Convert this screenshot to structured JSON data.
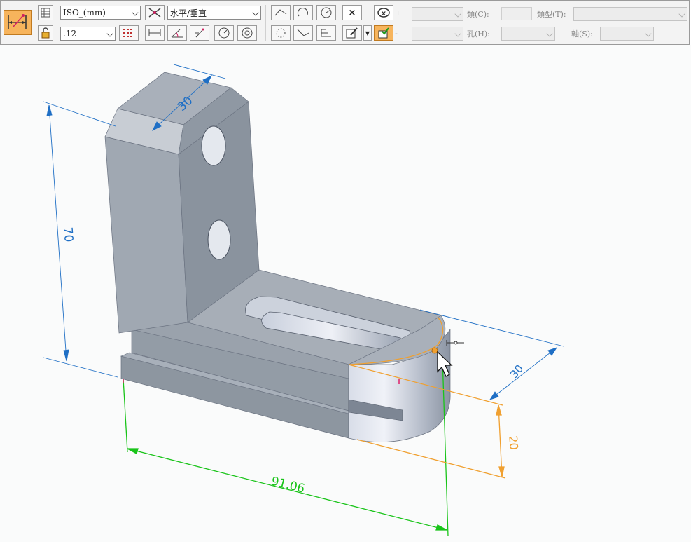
{
  "toolbar": {
    "style_dropdown": "ISO_(mm)",
    "precision_dropdown": ".12",
    "orientation_dropdown": "水平/垂直",
    "type_label": "類(C):",
    "type2_label": "類型(T):",
    "hole_label": "孔(H):",
    "axis_label": "軸(S):",
    "plus_sign": "+",
    "minus_sign": "-"
  },
  "dimensions": {
    "height": "70",
    "top_width": "30",
    "depth_right": "30",
    "length": "91.06",
    "thickness": "20"
  },
  "colors": {
    "blue_dim": "#1f6fc5",
    "green_dim": "#19c419",
    "orange_dim": "#f0a030",
    "part_face": "#9aa2ab",
    "highlight_accent": "#f7b45c"
  }
}
